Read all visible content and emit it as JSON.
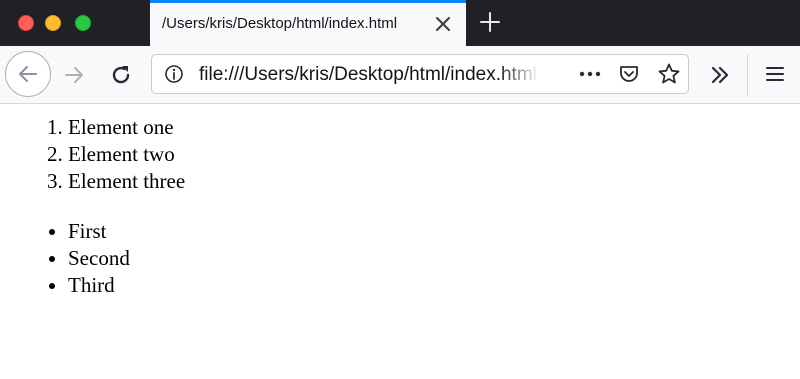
{
  "window": {
    "controls": [
      "close-icon",
      "minimize-icon",
      "maximize-icon"
    ],
    "tab": {
      "title": "/Users/kris/Desktop/html/index.html"
    }
  },
  "toolbar": {
    "url": "file:///Users/kris/Desktop/html/index.html",
    "icons": [
      "back-arrow-icon",
      "forward-arrow-icon",
      "reload-icon",
      "info-icon",
      "more-icon",
      "pocket-icon",
      "star-icon",
      "overflow-chevrons-icon",
      "hamburger-menu-icon"
    ]
  },
  "colors": {
    "tab_accent": "#0a84ff",
    "tabstrip_bg": "#202124",
    "toolbar_bg": "#f9f9fb"
  },
  "content": {
    "ordered_list": [
      "Element one",
      "Element two",
      "Element three"
    ],
    "unordered_list": [
      "First",
      "Second",
      "Third"
    ]
  }
}
